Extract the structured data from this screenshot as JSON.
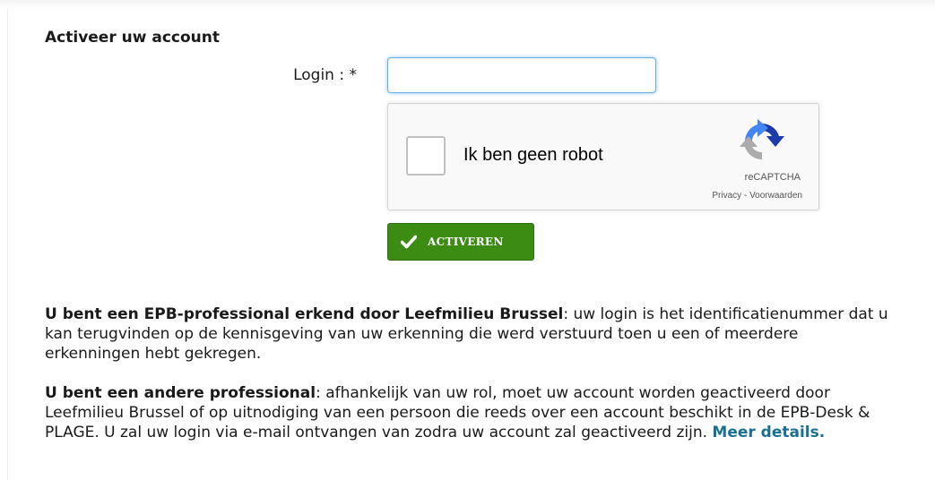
{
  "form": {
    "title": "Activeer uw account",
    "login_label": "Login : *",
    "login_value": ""
  },
  "captcha": {
    "label": "Ik ben geen robot",
    "brand": "reCAPTCHA",
    "privacy": "Privacy",
    "separator": " - ",
    "terms": "Voorwaarden",
    "icon": "recaptcha-logo-icon"
  },
  "button": {
    "label": "ACTIVEREN",
    "icon": "check-icon",
    "color": "#3c8c14"
  },
  "info": {
    "para1_bold": "U bent een EPB-professional erkend door Leefmilieu Brussel",
    "para1_text": ": uw login is het identificatienummer dat u kan terugvinden op de kennisgeving van uw erkenning die werd verstuurd toen u een of meerdere erkenningen hebt gekregen.",
    "para2_bold": "U bent een andere professional",
    "para2_text": ": afhankelijk van uw rol, moet uw account worden geactiveerd door Leefmilieu Brussel of op uitnodiging van een persoon die reeds over een account beschikt in de EPB-Desk & PLAGE. U zal uw login via e-mail ontvangen van zodra uw account zal geactiveerd zijn. ",
    "more_link": "Meer details."
  }
}
